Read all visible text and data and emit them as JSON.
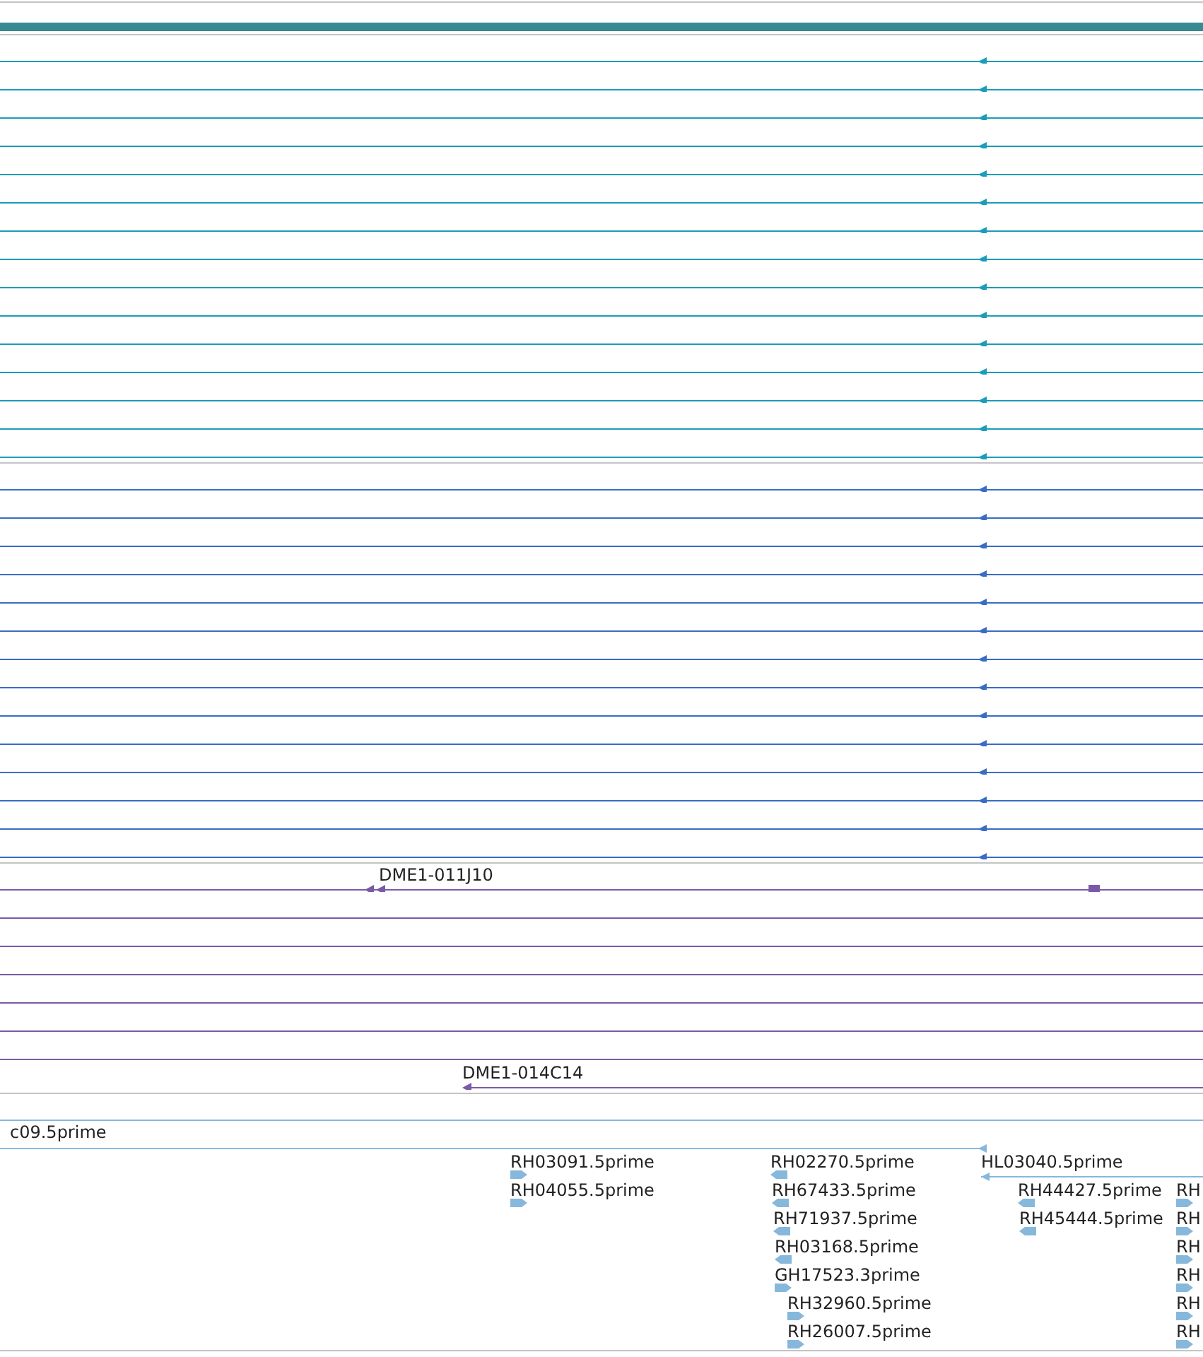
{
  "tracks": [
    {
      "color": "#1b9cb8",
      "features": [
        {
          "kind": "reverse"
        },
        {
          "kind": "reverse"
        },
        {
          "kind": "reverse"
        },
        {
          "kind": "reverse"
        },
        {
          "kind": "reverse"
        },
        {
          "kind": "reverse"
        },
        {
          "kind": "reverse"
        },
        {
          "kind": "reverse"
        },
        {
          "kind": "reverse"
        },
        {
          "kind": "reverse"
        },
        {
          "kind": "reverse"
        },
        {
          "kind": "reverse"
        },
        {
          "kind": "reverse"
        },
        {
          "kind": "reverse"
        },
        {
          "kind": "reverse"
        }
      ]
    },
    {
      "color": "#3a6cc4",
      "features": [
        {
          "kind": "reverse"
        },
        {
          "kind": "reverse"
        },
        {
          "kind": "reverse"
        },
        {
          "kind": "reverse"
        },
        {
          "kind": "reverse"
        },
        {
          "kind": "reverse"
        },
        {
          "kind": "reverse"
        },
        {
          "kind": "reverse"
        },
        {
          "kind": "reverse"
        },
        {
          "kind": "reverse"
        },
        {
          "kind": "reverse"
        },
        {
          "kind": "reverse"
        },
        {
          "kind": "reverse"
        },
        {
          "kind": "reverse"
        }
      ]
    },
    {
      "color": "#7a5aa8",
      "features": [
        {
          "label": "DME1-011J10",
          "kind": "reverse"
        },
        {
          "kind": "plain"
        },
        {
          "kind": "plain"
        },
        {
          "kind": "plain"
        },
        {
          "kind": "plain"
        },
        {
          "kind": "plain"
        },
        {
          "kind": "plain"
        },
        {
          "label": "DME1-014C14",
          "kind": "reverse"
        }
      ]
    },
    {
      "color": "#86b8dc",
      "features": [
        {
          "kind": "plain"
        },
        {
          "label": "c09.5prime",
          "kind": "reverse"
        },
        {
          "label": "RH03091.5prime",
          "kind": "forward"
        },
        {
          "label": "RH02270.5prime",
          "kind": "reverse"
        },
        {
          "label": "HL03040.5prime",
          "kind": "reverse"
        },
        {
          "label": "RH04055.5prime",
          "kind": "forward"
        },
        {
          "label": "RH67433.5prime",
          "kind": "reverse"
        },
        {
          "label": "RH44427.5prime",
          "kind": "reverse"
        },
        {
          "label": "RH",
          "kind": "forward"
        },
        {
          "label": "RH71937.5prime",
          "kind": "reverse"
        },
        {
          "label": "RH45444.5prime",
          "kind": "reverse"
        },
        {
          "label": "RH",
          "kind": "forward"
        },
        {
          "label": "RH03168.5prime",
          "kind": "reverse"
        },
        {
          "label": "RH",
          "kind": "forward"
        },
        {
          "label": "GH17523.3prime",
          "kind": "forward"
        },
        {
          "label": "RH",
          "kind": "forward"
        },
        {
          "label": "RH32960.5prime",
          "kind": "forward"
        },
        {
          "label": "RH",
          "kind": "forward"
        },
        {
          "label": "RH26007.5prime",
          "kind": "forward"
        },
        {
          "label": "RH",
          "kind": "forward"
        }
      ]
    }
  ]
}
